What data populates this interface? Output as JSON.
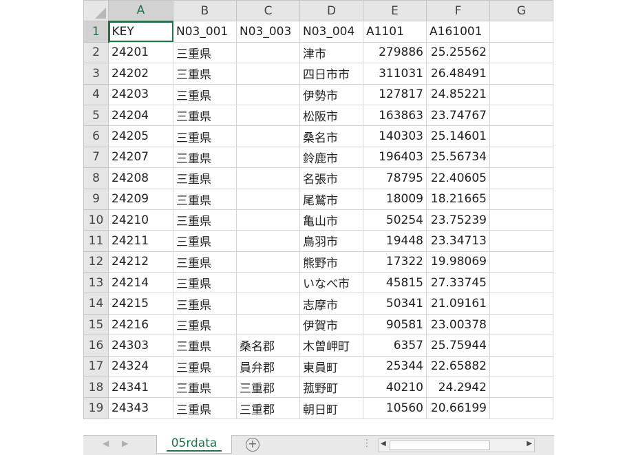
{
  "columns": [
    "A",
    "B",
    "C",
    "D",
    "E",
    "F",
    "G"
  ],
  "active_column": "A",
  "active_row": "1",
  "rows": [
    {
      "num": "1",
      "cells": [
        "KEY",
        "N03_001",
        "N03_003",
        "N03_004",
        "A1101",
        "A161001",
        ""
      ]
    },
    {
      "num": "2",
      "cells": [
        "24201",
        "三重県",
        "",
        "津市",
        "279886",
        "25.25562",
        ""
      ]
    },
    {
      "num": "3",
      "cells": [
        "24202",
        "三重県",
        "",
        "四日市市",
        "311031",
        "26.48491",
        ""
      ]
    },
    {
      "num": "4",
      "cells": [
        "24203",
        "三重県",
        "",
        "伊勢市",
        "127817",
        "24.85221",
        ""
      ]
    },
    {
      "num": "5",
      "cells": [
        "24204",
        "三重県",
        "",
        "松阪市",
        "163863",
        "23.74767",
        ""
      ]
    },
    {
      "num": "6",
      "cells": [
        "24205",
        "三重県",
        "",
        "桑名市",
        "140303",
        "25.14601",
        ""
      ]
    },
    {
      "num": "7",
      "cells": [
        "24207",
        "三重県",
        "",
        "鈴鹿市",
        "196403",
        "25.56734",
        ""
      ]
    },
    {
      "num": "8",
      "cells": [
        "24208",
        "三重県",
        "",
        "名張市",
        "78795",
        "22.40605",
        ""
      ]
    },
    {
      "num": "9",
      "cells": [
        "24209",
        "三重県",
        "",
        "尾鷲市",
        "18009",
        "18.21665",
        ""
      ]
    },
    {
      "num": "10",
      "cells": [
        "24210",
        "三重県",
        "",
        "亀山市",
        "50254",
        "23.75239",
        ""
      ]
    },
    {
      "num": "11",
      "cells": [
        "24211",
        "三重県",
        "",
        "鳥羽市",
        "19448",
        "23.34713",
        ""
      ]
    },
    {
      "num": "12",
      "cells": [
        "24212",
        "三重県",
        "",
        "熊野市",
        "17322",
        "19.98069",
        ""
      ]
    },
    {
      "num": "13",
      "cells": [
        "24214",
        "三重県",
        "",
        "いなべ市",
        "45815",
        "27.33745",
        ""
      ]
    },
    {
      "num": "14",
      "cells": [
        "24215",
        "三重県",
        "",
        "志摩市",
        "50341",
        "21.09161",
        ""
      ]
    },
    {
      "num": "15",
      "cells": [
        "24216",
        "三重県",
        "",
        "伊賀市",
        "90581",
        "23.00378",
        ""
      ]
    },
    {
      "num": "16",
      "cells": [
        "24303",
        "三重県",
        "桑名郡",
        "木曽岬町",
        "6357",
        "25.75944",
        ""
      ]
    },
    {
      "num": "17",
      "cells": [
        "24324",
        "三重県",
        "員弁郡",
        "東員町",
        "25344",
        "22.65882",
        ""
      ]
    },
    {
      "num": "18",
      "cells": [
        "24341",
        "三重県",
        "三重郡",
        "菰野町",
        "40210",
        "24.2942",
        ""
      ]
    },
    {
      "num": "19",
      "cells": [
        "24343",
        "三重県",
        "三重郡",
        "朝日町",
        "10560",
        "20.66199",
        ""
      ]
    }
  ],
  "sheet_tab": {
    "label": "05rdata"
  },
  "icons": {
    "add_sheet": "plus-circle-icon",
    "cursor": "cell-select-cross-cursor-icon"
  },
  "accent_color": "#217346"
}
